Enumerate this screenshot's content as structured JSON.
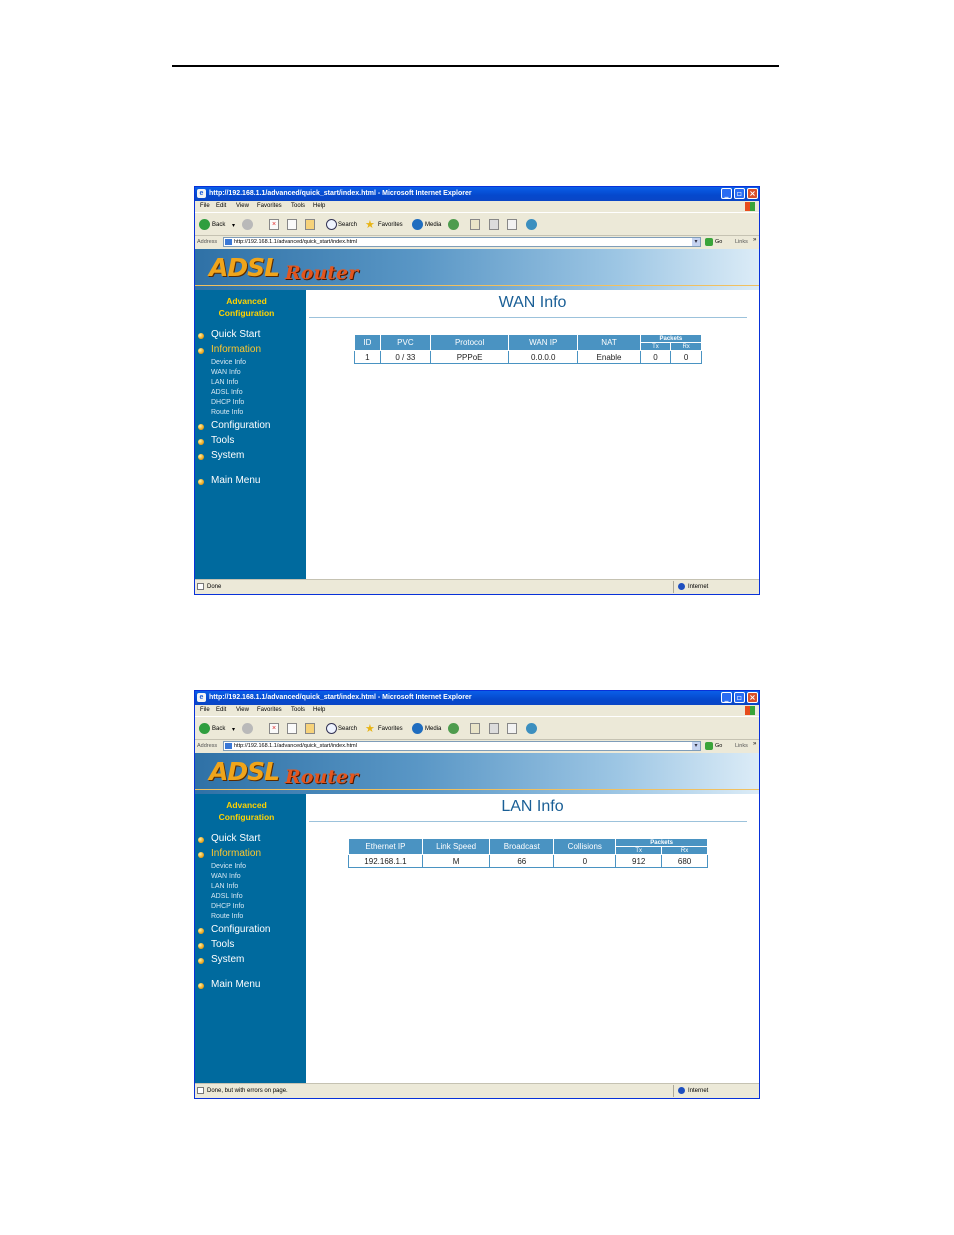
{
  "windows": [
    {
      "window_title": "http://192.168.1.1/advanced/quick_start/index.html - Microsoft Internet Explorer",
      "menu": [
        "File",
        "Edit",
        "View",
        "Favorites",
        "Tools",
        "Help"
      ],
      "toolbar": {
        "back": "Back",
        "search": "Search",
        "favorites": "Favorites",
        "media": "Media"
      },
      "address": {
        "label": "Address",
        "url": "http://192.168.1.1/advanced/quick_start/index.html",
        "go": "Go",
        "links": "Links"
      },
      "banner": {
        "adsl": "ADSL",
        "router": "Router"
      },
      "sidebar": {
        "title_line1": "Advanced",
        "title_line2": "Configuration",
        "items": [
          "Quick Start",
          "Information",
          "Configuration",
          "Tools",
          "System",
          "Main Menu"
        ],
        "sub_items": [
          "Device Info",
          "WAN Info",
          "LAN Info",
          "ADSL Info",
          "DHCP Info",
          "Route Info"
        ]
      },
      "page_title": "WAN Info",
      "table": {
        "headers": [
          "ID",
          "PVC",
          "Protocol",
          "WAN IP",
          "NAT"
        ],
        "packets_header": "Packets",
        "packets_sub": [
          "Tx",
          "Rx"
        ],
        "rows": [
          [
            "1",
            "0 / 33",
            "PPPoE",
            "0.0.0.0",
            "Enable",
            "0",
            "0"
          ]
        ]
      },
      "status": {
        "text": "Done",
        "zone": "Internet"
      }
    },
    {
      "window_title": "http://192.168.1.1/advanced/quick_start/index.html - Microsoft Internet Explorer",
      "menu": [
        "File",
        "Edit",
        "View",
        "Favorites",
        "Tools",
        "Help"
      ],
      "toolbar": {
        "back": "Back",
        "search": "Search",
        "favorites": "Favorites",
        "media": "Media"
      },
      "address": {
        "label": "Address",
        "url": "http://192.168.1.1/advanced/quick_start/index.html",
        "go": "Go",
        "links": "Links"
      },
      "banner": {
        "adsl": "ADSL",
        "router": "Router"
      },
      "sidebar": {
        "title_line1": "Advanced",
        "title_line2": "Configuration",
        "items": [
          "Quick Start",
          "Information",
          "Configuration",
          "Tools",
          "System",
          "Main Menu"
        ],
        "sub_items": [
          "Device Info",
          "WAN Info",
          "LAN Info",
          "ADSL Info",
          "DHCP Info",
          "Route Info"
        ]
      },
      "page_title": "LAN Info",
      "table": {
        "headers": [
          "Ethernet IP",
          "Link Speed",
          "Broadcast",
          "Collisions"
        ],
        "packets_header": "Packets",
        "packets_sub": [
          "Tx",
          "Rx"
        ],
        "rows": [
          [
            "192.168.1.1",
            "M",
            "66",
            "0",
            "912",
            "680"
          ]
        ]
      },
      "status": {
        "text": "Done, but with errors on page.",
        "zone": "Internet"
      }
    }
  ],
  "colors": {
    "sidebar_bg": "#006a9e",
    "table_header_bg": "#4a93c2",
    "active_item": "#ffc72c",
    "title_blue": "#1a5f96",
    "xp_titlebar": "#0548cc"
  }
}
